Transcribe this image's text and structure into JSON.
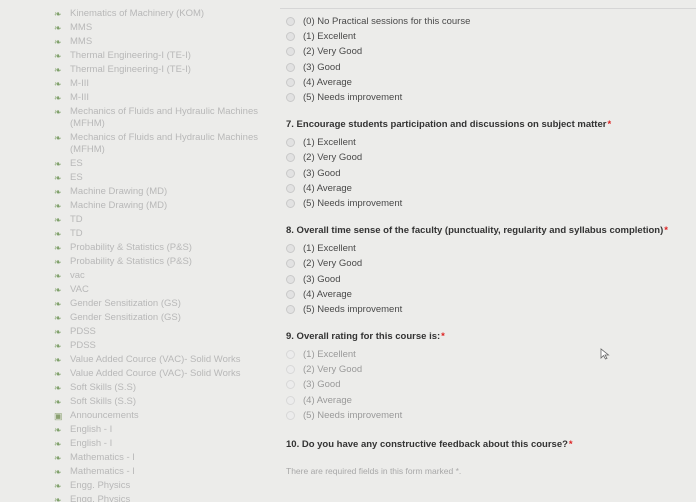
{
  "sidebar": {
    "items": [
      {
        "label": "Kinematics of Machinery (KOM)",
        "icon": "course-icon"
      },
      {
        "label": "MMS",
        "icon": "course-icon"
      },
      {
        "label": "MMS",
        "icon": "course-icon"
      },
      {
        "label": "Thermal Engineering-I (TE-I)",
        "icon": "course-icon"
      },
      {
        "label": "Thermal Engineering-I (TE-I)",
        "icon": "course-icon"
      },
      {
        "label": "M-III",
        "icon": "course-icon"
      },
      {
        "label": "M-III",
        "icon": "course-icon"
      },
      {
        "label": "Mechanics of Fluids and Hydraulic Machines (MFHM)",
        "icon": "course-icon"
      },
      {
        "label": "Mechanics of Fluids and Hydraulic Machines (MFHM)",
        "icon": "course-icon"
      },
      {
        "label": "ES",
        "icon": "course-icon"
      },
      {
        "label": "ES",
        "icon": "course-icon"
      },
      {
        "label": "Machine Drawing (MD)",
        "icon": "course-icon"
      },
      {
        "label": "Machine Drawing (MD)",
        "icon": "course-icon"
      },
      {
        "label": "TD",
        "icon": "course-icon"
      },
      {
        "label": "TD",
        "icon": "course-icon"
      },
      {
        "label": "Probability & Statistics (P&S)",
        "icon": "course-icon"
      },
      {
        "label": "Probability & Statistics (P&S)",
        "icon": "course-icon"
      },
      {
        "label": "vac",
        "icon": "course-icon"
      },
      {
        "label": "VAC",
        "icon": "course-icon"
      },
      {
        "label": "Gender Sensitization (GS)",
        "icon": "course-icon"
      },
      {
        "label": "Gender Sensitization (GS)",
        "icon": "course-icon"
      },
      {
        "label": "PDSS",
        "icon": "course-icon"
      },
      {
        "label": "PDSS",
        "icon": "course-icon"
      },
      {
        "label": "Value Added Cource (VAC)- Solid Works",
        "icon": "course-icon"
      },
      {
        "label": "Value Added Cource (VAC)- Solid Works",
        "icon": "course-icon"
      },
      {
        "label": "Soft Skills (S.S)",
        "icon": "course-icon"
      },
      {
        "label": "Soft Skills (S.S)",
        "icon": "course-icon"
      },
      {
        "label": "Announcements",
        "icon": "announcement-icon"
      },
      {
        "label": "English - I",
        "icon": "course-icon"
      },
      {
        "label": "English - I",
        "icon": "course-icon"
      },
      {
        "label": "Mathematics - I",
        "icon": "course-icon"
      },
      {
        "label": "Mathematics - I",
        "icon": "course-icon"
      },
      {
        "label": "Engg. Physics",
        "icon": "course-icon"
      },
      {
        "label": "Engg. Physics",
        "icon": "course-icon"
      }
    ]
  },
  "form": {
    "q6_options": [
      "(0) No Practical sessions for this course",
      "(1) Excellent",
      "(2) Very Good",
      "(3) Good",
      "(4) Average",
      "(5) Needs improvement"
    ],
    "q7": {
      "title": "7. Encourage students participation and discussions on subject matter",
      "required_mark": "*",
      "options": [
        "(1) Excellent",
        "(2) Very Good",
        "(3) Good",
        "(4) Average",
        "(5) Needs improvement"
      ]
    },
    "q8": {
      "title": "8. Overall time sense of the faculty (punctuality, regularity and syllabus completion)",
      "required_mark": "*",
      "options": [
        "(1) Excellent",
        "(2) Very Good",
        "(3) Good",
        "(4) Average",
        "(5) Needs improvement"
      ]
    },
    "q9": {
      "title": "9. Overall rating for this course is:",
      "required_mark": "*",
      "options": [
        "(1) Excellent",
        "(2) Very Good",
        "(3) Good",
        "(4) Average",
        "(5) Needs improvement"
      ]
    },
    "q10": {
      "title": "10. Do you have any constructive feedback about this course?",
      "required_mark": "*"
    },
    "footer_note": "There are required fields in this form marked *."
  },
  "colors": {
    "background": "#ececea",
    "required": "#dd2222",
    "sidebar_text": "#b8b8b8"
  }
}
